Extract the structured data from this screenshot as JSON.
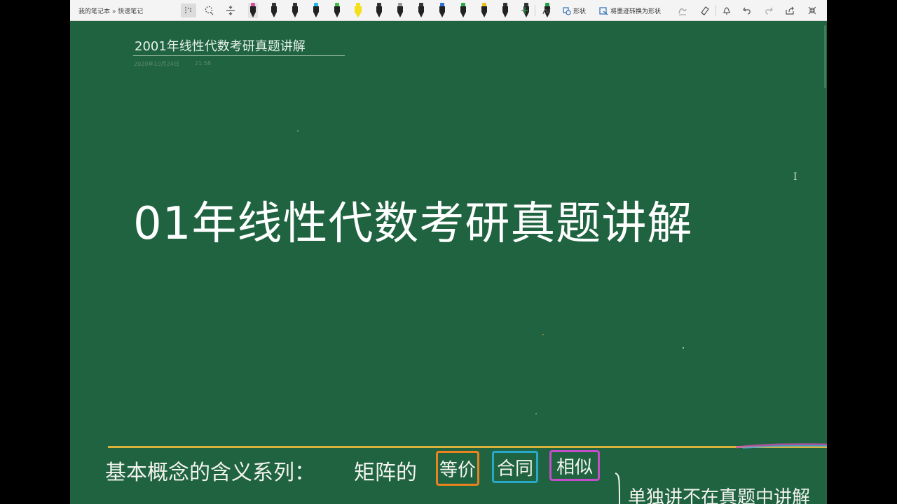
{
  "toolbar": {
    "breadcrumb": "我的笔记本 » 快速笔记",
    "shape_label": "形状",
    "ink_to_shape_label": "将墨迹转换为形状",
    "pens": [
      {
        "name": "pen-black",
        "cap": "#d94f9c"
      },
      {
        "name": "pen-black-2",
        "cap": "#333333"
      },
      {
        "name": "pen-black-3",
        "cap": "#333333"
      },
      {
        "name": "pen-cyan",
        "cap": "#21b7e6"
      },
      {
        "name": "pen-green",
        "cap": "#3fbf3f"
      },
      {
        "name": "pen-yellow",
        "cap": "#f3e01b",
        "highlighter": true
      },
      {
        "name": "pen-black-4",
        "cap": "#333333"
      },
      {
        "name": "pen-gray",
        "cap": "#9a9a9a"
      },
      {
        "name": "pen-black-5",
        "cap": "#333333"
      },
      {
        "name": "pen-blue",
        "cap": "#2a6fdb"
      },
      {
        "name": "pen-green-2",
        "cap": "#2fa84f"
      },
      {
        "name": "pen-yellow-2",
        "cap": "#e8c21b"
      },
      {
        "name": "pen-black-6",
        "cap": "#333333"
      },
      {
        "name": "pen-black-7",
        "cap": "#333333"
      },
      {
        "name": "pen-green-3",
        "cap": "#23a04a"
      }
    ]
  },
  "page": {
    "title": "2001年线性代数考研真题讲解",
    "date": "2020年10月24日",
    "time": "21:58",
    "heading": "01年线性代数考研真题讲解"
  },
  "handwriting": {
    "line1": "基本概念的含义系列：",
    "matrix_prefix": "矩阵的",
    "boxes": [
      {
        "text": "等价",
        "color": "#e8831f"
      },
      {
        "text": "合同",
        "color": "#2aa8c9"
      },
      {
        "text": "相似",
        "color": "#c24fc9"
      }
    ],
    "side_note": "单独讲不在真题中讲解"
  },
  "colors": {
    "board": "#1f6340",
    "rule": "#d9b13b"
  }
}
